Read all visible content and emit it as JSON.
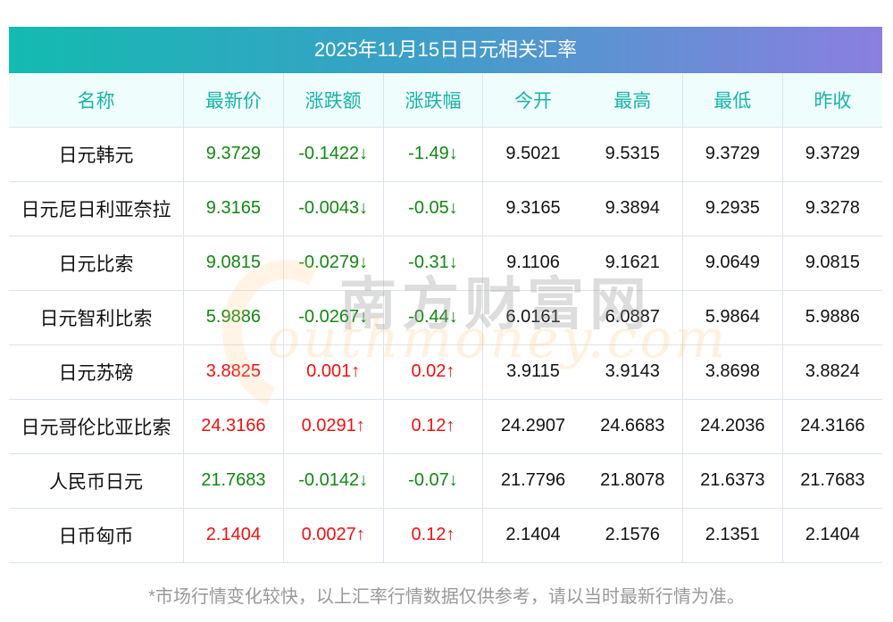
{
  "title": "2025年11月15日日元相关汇率",
  "headers": [
    "名称",
    "最新价",
    "涨跌额",
    "涨跌幅",
    "今开",
    "最高",
    "最低",
    "昨收"
  ],
  "rows": [
    {
      "name": "日元韩元",
      "price": "9.3729",
      "change": "-0.1422↓",
      "pct": "-1.49↓",
      "open": "9.5021",
      "high": "9.5315",
      "low": "9.3729",
      "prev": "9.3729",
      "dir": "down"
    },
    {
      "name": "日元尼日利亚奈拉",
      "price": "9.3165",
      "change": "-0.0043↓",
      "pct": "-0.05↓",
      "open": "9.3165",
      "high": "9.3894",
      "low": "9.2935",
      "prev": "9.3278",
      "dir": "down"
    },
    {
      "name": "日元比索",
      "price": "9.0815",
      "change": "-0.0279↓",
      "pct": "-0.31↓",
      "open": "9.1106",
      "high": "9.1621",
      "low": "9.0649",
      "prev": "9.0815",
      "dir": "down"
    },
    {
      "name": "日元智利比索",
      "price": "5.9886",
      "change": "-0.0267↓",
      "pct": "-0.44↓",
      "open": "6.0161",
      "high": "6.0887",
      "low": "5.9864",
      "prev": "5.9886",
      "dir": "down"
    },
    {
      "name": "日元苏磅",
      "price": "3.8825",
      "change": "0.001↑",
      "pct": "0.02↑",
      "open": "3.9115",
      "high": "3.9143",
      "low": "3.8698",
      "prev": "3.8824",
      "dir": "up"
    },
    {
      "name": "日元哥伦比亚比索",
      "price": "24.3166",
      "change": "0.0291↑",
      "pct": "0.12↑",
      "open": "24.2907",
      "high": "24.6683",
      "low": "24.2036",
      "prev": "24.3166",
      "dir": "up"
    },
    {
      "name": "人民币日元",
      "price": "21.7683",
      "change": "-0.0142↓",
      "pct": "-0.07↓",
      "open": "21.7796",
      "high": "21.8078",
      "low": "21.6373",
      "prev": "21.7683",
      "dir": "down"
    },
    {
      "name": "日币匈币",
      "price": "2.1404",
      "change": "0.0027↑",
      "pct": "0.12↑",
      "open": "2.1404",
      "high": "2.1576",
      "low": "2.1351",
      "prev": "2.1404",
      "dir": "up"
    }
  ],
  "watermark": {
    "cn": "南方财富网",
    "en": "outhmoney.com"
  },
  "footer": "*市场行情变化较快，以上汇率行情数据仅供参考，请以当时最新行情为准。",
  "colors": {
    "up": "#f01010",
    "down": "#118811",
    "header_text": "#19b3a6"
  }
}
